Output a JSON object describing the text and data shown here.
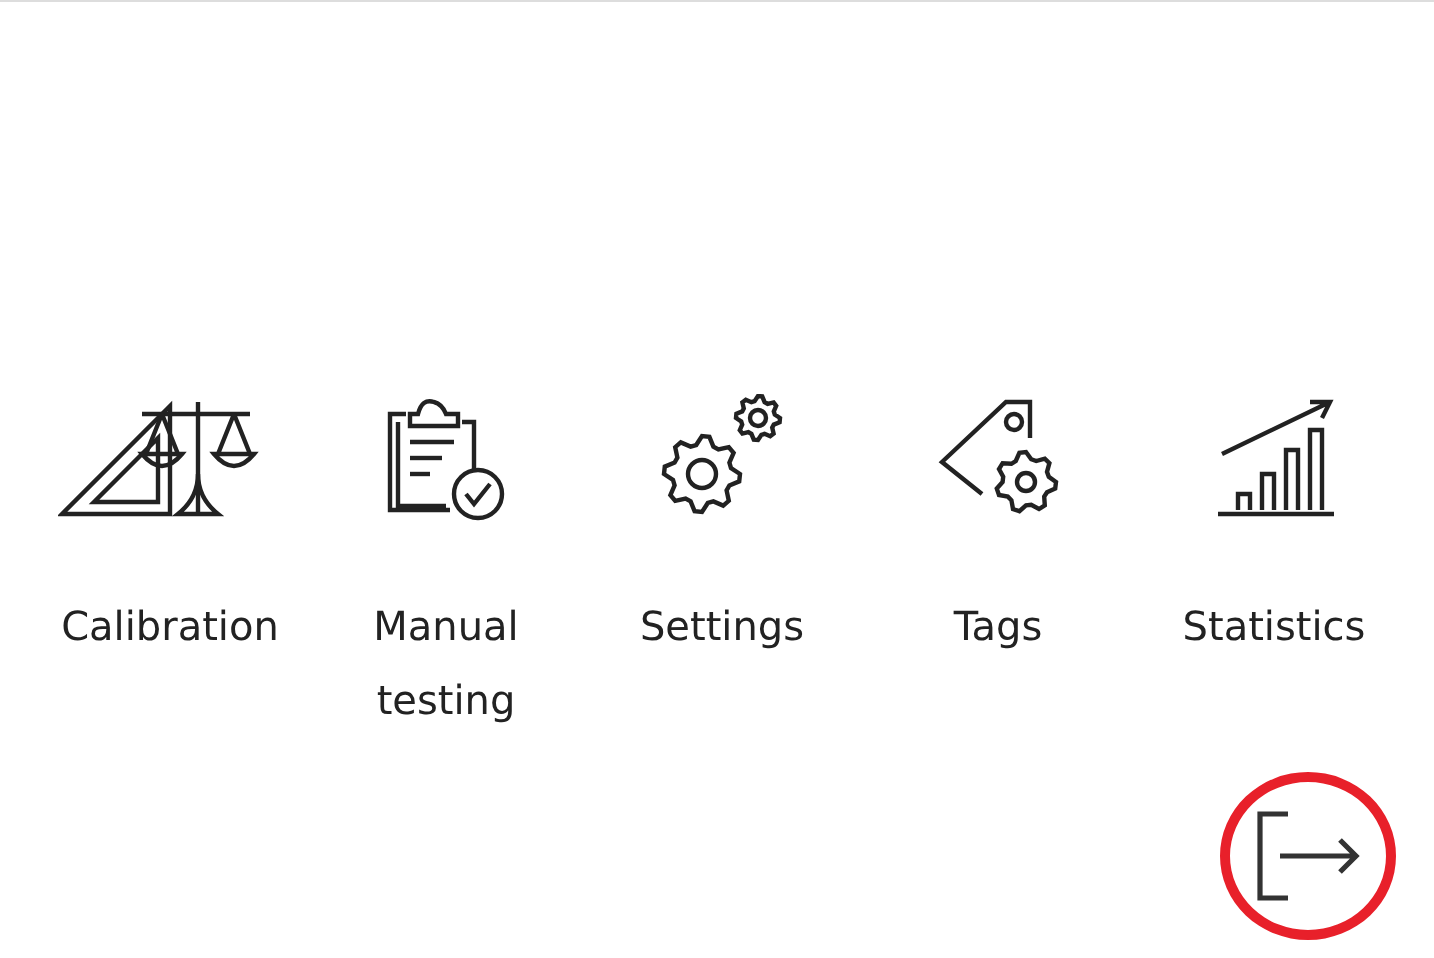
{
  "tiles": [
    {
      "kind": "calibration",
      "label": "Calibration"
    },
    {
      "kind": "manual",
      "label": "Manual testing"
    },
    {
      "kind": "settings",
      "label": "Settings"
    },
    {
      "kind": "tags",
      "label": "Tags"
    },
    {
      "kind": "statistics",
      "label": "Statistics"
    }
  ],
  "exit_button": {
    "highlighted": true
  }
}
